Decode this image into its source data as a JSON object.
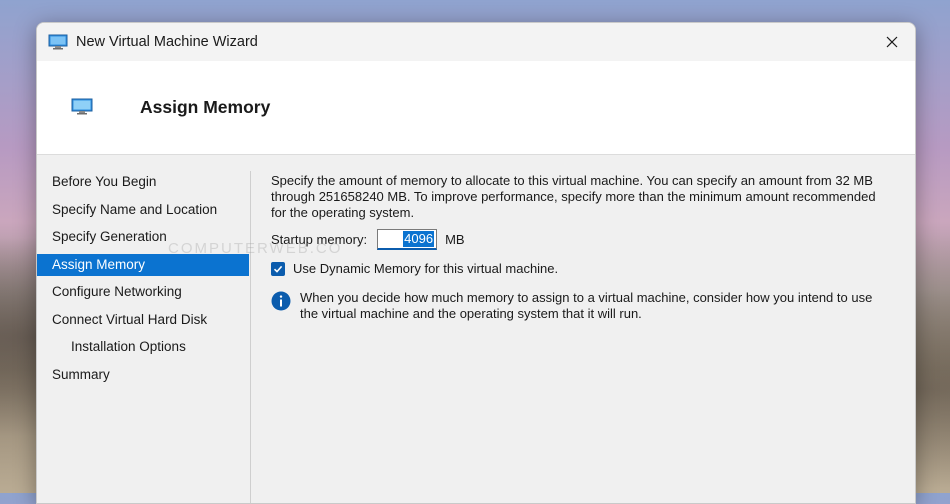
{
  "window": {
    "title": "New Virtual Machine Wizard",
    "icon": "monitor-icon"
  },
  "header": {
    "page_title": "Assign Memory",
    "icon": "monitor-icon"
  },
  "steps": [
    {
      "label": "Before You Begin",
      "active": false,
      "indent": false
    },
    {
      "label": "Specify Name and Location",
      "active": false,
      "indent": false
    },
    {
      "label": "Specify Generation",
      "active": false,
      "indent": false
    },
    {
      "label": "Assign Memory",
      "active": true,
      "indent": false
    },
    {
      "label": "Configure Networking",
      "active": false,
      "indent": false
    },
    {
      "label": "Connect Virtual Hard Disk",
      "active": false,
      "indent": false
    },
    {
      "label": "Installation Options",
      "active": false,
      "indent": true
    },
    {
      "label": "Summary",
      "active": false,
      "indent": false
    }
  ],
  "content": {
    "description": "Specify the amount of memory to allocate to this virtual machine. You can specify an amount from 32 MB through 251658240 MB. To improve performance, specify more than the minimum amount recommended for the operating system.",
    "startup_memory_label": "Startup memory:",
    "startup_memory_value": "4096",
    "startup_memory_unit": "MB",
    "dynamic_memory_label": "Use Dynamic Memory for this virtual machine.",
    "dynamic_memory_checked": true,
    "info_text": "When you decide how much memory to assign to a virtual machine, consider how you intend to use the virtual machine and the operating system that it will run."
  },
  "watermark": "COMPUTERWEB.CO",
  "colors": {
    "accent": "#0b73d0",
    "info_icon": "#0b5cad"
  }
}
